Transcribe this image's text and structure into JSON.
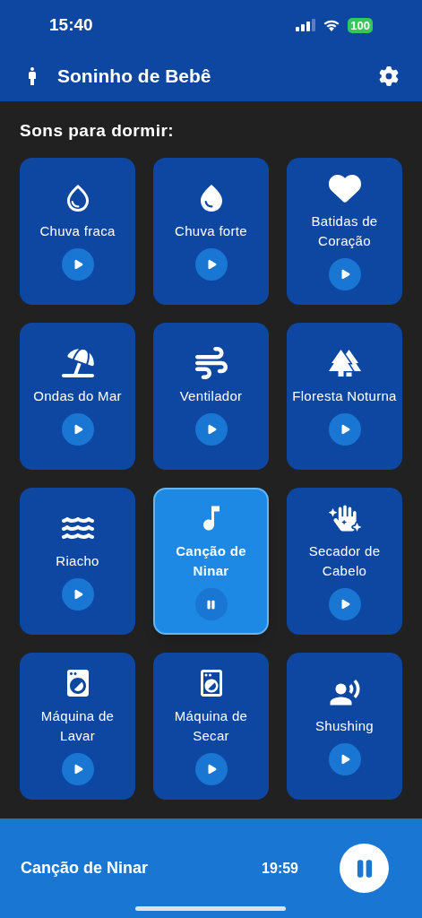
{
  "status_bar": {
    "time": "15:40",
    "battery": "100"
  },
  "header": {
    "title": "Soninho de Bebê"
  },
  "section_title": "Sons para dormir:",
  "sounds": [
    {
      "label": "Chuva fraca",
      "playing": false
    },
    {
      "label": "Chuva forte",
      "playing": false
    },
    {
      "label": "Batidas de Coração",
      "playing": false
    },
    {
      "label": "Ondas do Mar",
      "playing": false
    },
    {
      "label": "Ventilador",
      "playing": false
    },
    {
      "label": "Floresta Noturna",
      "playing": false
    },
    {
      "label": "Riacho",
      "playing": false
    },
    {
      "label": "Canção de Ninar",
      "playing": true
    },
    {
      "label": "Secador de Cabelo",
      "playing": false
    },
    {
      "label": "Máquina de Lavar",
      "playing": false
    },
    {
      "label": "Máquina de Secar",
      "playing": false
    },
    {
      "label": "Shushing",
      "playing": false
    }
  ],
  "now_playing": {
    "title": "Canção de Ninar",
    "time": "19:59",
    "playing": true
  }
}
